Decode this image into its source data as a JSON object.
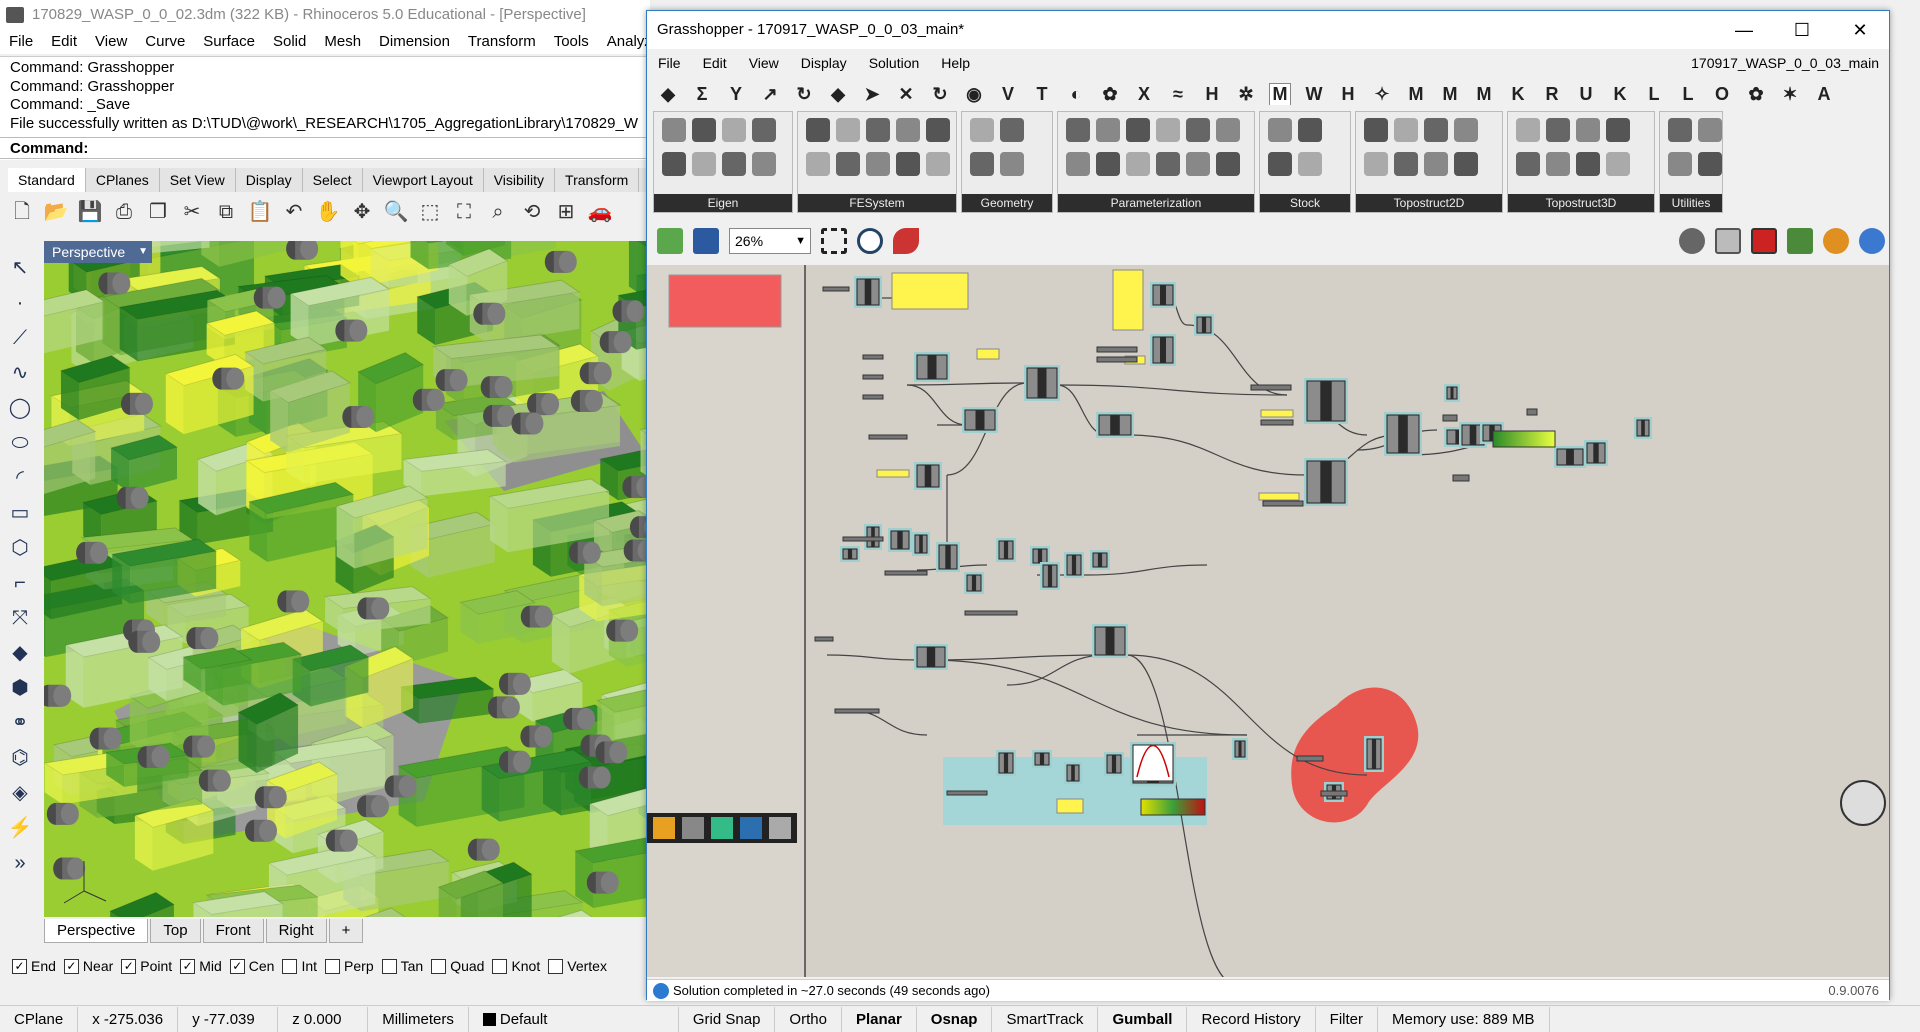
{
  "rhino": {
    "title": "170829_WASP_0_0_02.3dm (322 KB) - Rhinoceros 5.0 Educational - [Perspective]",
    "menu": [
      "File",
      "Edit",
      "View",
      "Curve",
      "Surface",
      "Solid",
      "Mesh",
      "Dimension",
      "Transform",
      "Tools",
      "Analyze"
    ],
    "command_history": [
      "Command: Grasshopper",
      "Command: Grasshopper",
      "Command: _Save",
      "File successfully written as D:\\TUD\\@work\\_RESEARCH\\1705_AggregationLibrary\\170829_W"
    ],
    "command_prompt": "Command:",
    "toolbar_tabs": [
      "Standard",
      "CPlanes",
      "Set View",
      "Display",
      "Select",
      "Viewport Layout",
      "Visibility",
      "Transform",
      "C"
    ],
    "viewport_label": "Perspective",
    "viewport_tabs": [
      "Perspective",
      "Top",
      "Front",
      "Right",
      "+"
    ],
    "osnaps": [
      {
        "label": "End",
        "checked": true
      },
      {
        "label": "Near",
        "checked": true
      },
      {
        "label": "Point",
        "checked": true
      },
      {
        "label": "Mid",
        "checked": true
      },
      {
        "label": "Cen",
        "checked": true
      },
      {
        "label": "Int",
        "checked": false
      },
      {
        "label": "Perp",
        "checked": false
      },
      {
        "label": "Tan",
        "checked": false
      },
      {
        "label": "Quad",
        "checked": false
      },
      {
        "label": "Knot",
        "checked": false
      },
      {
        "label": "Vertex",
        "checked": false
      }
    ],
    "status": {
      "cplane": "CPlane",
      "x": "x -275.036",
      "y": "y -77.039",
      "z": "z 0.000",
      "units": "Millimeters",
      "layer": "Default",
      "grid_snap": "Grid Snap",
      "ortho": "Ortho",
      "planar": "Planar",
      "osnap": "Osnap",
      "smarttrack": "SmartTrack",
      "gumball": "Gumball",
      "record_history": "Record History",
      "filter": "Filter",
      "memory": "Memory use: 889 MB"
    }
  },
  "grasshopper": {
    "title": "Grasshopper - 170917_WASP_0_0_03_main*",
    "win_buttons": [
      "—",
      "☐",
      "✕"
    ],
    "menu": [
      "File",
      "Edit",
      "View",
      "Display",
      "Solution",
      "Help"
    ],
    "filename": "170917_WASP_0_0_03_main",
    "tabs": [
      "◆",
      "Σ",
      "Y",
      "↗",
      "↻",
      "◆",
      "➤",
      "✕",
      "↻",
      "◉",
      "V",
      "T",
      "◐",
      "✿",
      "X",
      "≈",
      "H",
      "✲",
      "M",
      "W",
      "H",
      "✧",
      "M",
      "M",
      "M",
      "K",
      "R",
      "U",
      "K",
      "L",
      "L",
      "O",
      "✿",
      "✶",
      "A"
    ],
    "panels": [
      "Eigen",
      "FESystem",
      "Geometry",
      "Parameterization",
      "Stock",
      "Topostruct2D",
      "Topostruct3D",
      "Utilities"
    ],
    "zoom": "26%",
    "status_text": "Solution completed in ~27.0 seconds (49 seconds ago)",
    "version": "0.9.0076"
  },
  "colors": {
    "accent": "#2f7ac0",
    "panel_yellow": "#fff34d",
    "red_group": "#ef5350",
    "cyan_group": "#9fd6d8",
    "canvas": "#d4d0c8"
  }
}
